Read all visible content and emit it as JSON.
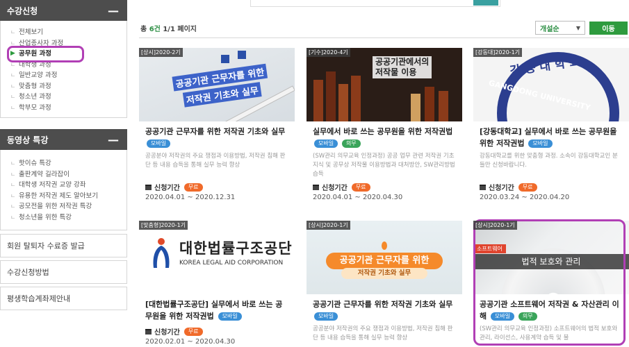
{
  "sidebar": {
    "section1_title": "수강신청",
    "section1_toggle": "—",
    "section1_items": [
      {
        "label": "전체보기"
      },
      {
        "label": "산업종사자 과정"
      },
      {
        "label": "공무원 과정",
        "active": true
      },
      {
        "label": "대학생 과정"
      },
      {
        "label": "일반교양 과정"
      },
      {
        "label": "맞춤형 과정"
      },
      {
        "label": "청소년 과정"
      },
      {
        "label": "학부모 과정"
      }
    ],
    "section2_title": "동영상 특강",
    "section2_toggle": "—",
    "section2_items": [
      {
        "label": "핫이슈 특강"
      },
      {
        "label": "출판계약 길라잡이"
      },
      {
        "label": "대학생 저작권 교양 강좌"
      },
      {
        "label": "유용한 저작권 제도 알아보기"
      },
      {
        "label": "공모전을 위한 저작권 특강"
      },
      {
        "label": "청소년을 위한 특강"
      }
    ],
    "links": [
      {
        "label": "회원 탈퇴자 수료증 발급"
      },
      {
        "label": "수강신청방법"
      },
      {
        "label": "평생학습계좌제안내"
      }
    ]
  },
  "summary": {
    "prefix": "총 ",
    "count": "6건",
    "pages": " 1/1 페이지"
  },
  "sort": {
    "selected": "개설순",
    "go_label": "이동"
  },
  "period_label": "신청기간",
  "badges": {
    "mobile": "모바일",
    "required": "의무",
    "free": "무료"
  },
  "courses": [
    {
      "tag": "[상시]2020-2기",
      "thumb_lines": [
        "공공기관 근무자를 위한",
        "저작권 기초와 실무"
      ],
      "title": "공공기관 근무자를 위한 저작권 기초와 실무",
      "desc": "공공분야 저작권의 주요 쟁점과 이용방법, 저작권 침해 판단 등 내용 습득을 통해 실무 능력 향상",
      "period": "2020.04.01 ~ 2020.12.31"
    },
    {
      "tag": "[기수]2020-4기",
      "thumb_lines": [
        "공공기관에서의",
        "저작물 이용"
      ],
      "title": "실무에서 바로 쓰는 공무원을 위한 저작권법",
      "desc": "(SW관리 의무교육 인정과정) 공공 업무 관련 저작권 기초 지식 및 공무상 저작물 이용방법과 대처방안, SW관리방법 습득",
      "period": "2020.04.01 ~ 2020.04.30"
    },
    {
      "tag": "[강동대]2020-1기",
      "thumb_lines": [
        "강 동 대 학 교",
        "GANGDONG UNIVERSITY"
      ],
      "title": "[강동대학교] 실무에서 바로 쓰는 공무원을 위한 저작권법",
      "desc": "강동대학교를 위한 맞춤형 과정. 소속이 강동대학교인 분들만 신청바랍니다.",
      "period": "2020.03.24 ~ 2020.04.20"
    },
    {
      "tag": "[맞춤형]2020-1기",
      "thumb_lines": [
        "대한법률구조공단",
        "KOREA LEGAL AID CORPORATION"
      ],
      "title": "[대한법률구조공단] 실무에서 바로 쓰는 공무원을 위한 저작권법",
      "desc": "",
      "period": "2020.02.01 ~ 2020.04.30"
    },
    {
      "tag": "[상시]2020-1기",
      "thumb_lines": [
        "공공기관 근무자를 위한",
        "저작권 기초와 실무"
      ],
      "title": "공공기관 근무자를 위한 저작권 기초와 실무",
      "desc": "공공분야 저작권의 주요 쟁점과 이용방법, 저작권 침해 판단 등 내용 습득을 통해 실무 능력 향상",
      "period": ""
    },
    {
      "tag": "[상시]2020-1기",
      "thumb_lines": [
        "소프트웨어",
        "법적 보호와 관리"
      ],
      "title": "공공기관 소프트웨어 저작권 & 자산관리 이해",
      "desc": "(SW관리 의무교육 인정과정) 소프트웨어의 법적 보호와 관리, 라이선스, 사용계약 습득 및 불",
      "period": ""
    }
  ]
}
